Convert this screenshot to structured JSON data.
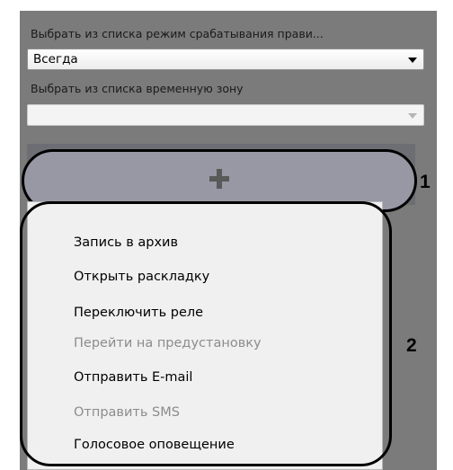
{
  "rule_mode": {
    "label": "Выбрать из списка режим срабатывания прави...",
    "value": "Всегда"
  },
  "time_zone": {
    "label": "Выбрать из списка временную зону",
    "value": ""
  },
  "add_button": {
    "icon": "plus-icon",
    "marker": "1"
  },
  "action_menu": {
    "marker": "2",
    "items": [
      {
        "label": "Запись в архив",
        "enabled": true
      },
      {
        "label": "Открыть раскладку",
        "enabled": true
      },
      {
        "label": "Переключить реле",
        "enabled": true
      },
      {
        "label": "Перейти на предустановку",
        "enabled": false
      },
      {
        "label": "Отправить E-mail",
        "enabled": true
      },
      {
        "label": "Отправить SMS",
        "enabled": false
      },
      {
        "label": "Голосовое оповещение",
        "enabled": true
      }
    ]
  },
  "colors": {
    "panel": "#7b7b7b",
    "button": "#9798a4",
    "menu": "#f0f0f0",
    "disabled_text": "#8c8c8c"
  }
}
